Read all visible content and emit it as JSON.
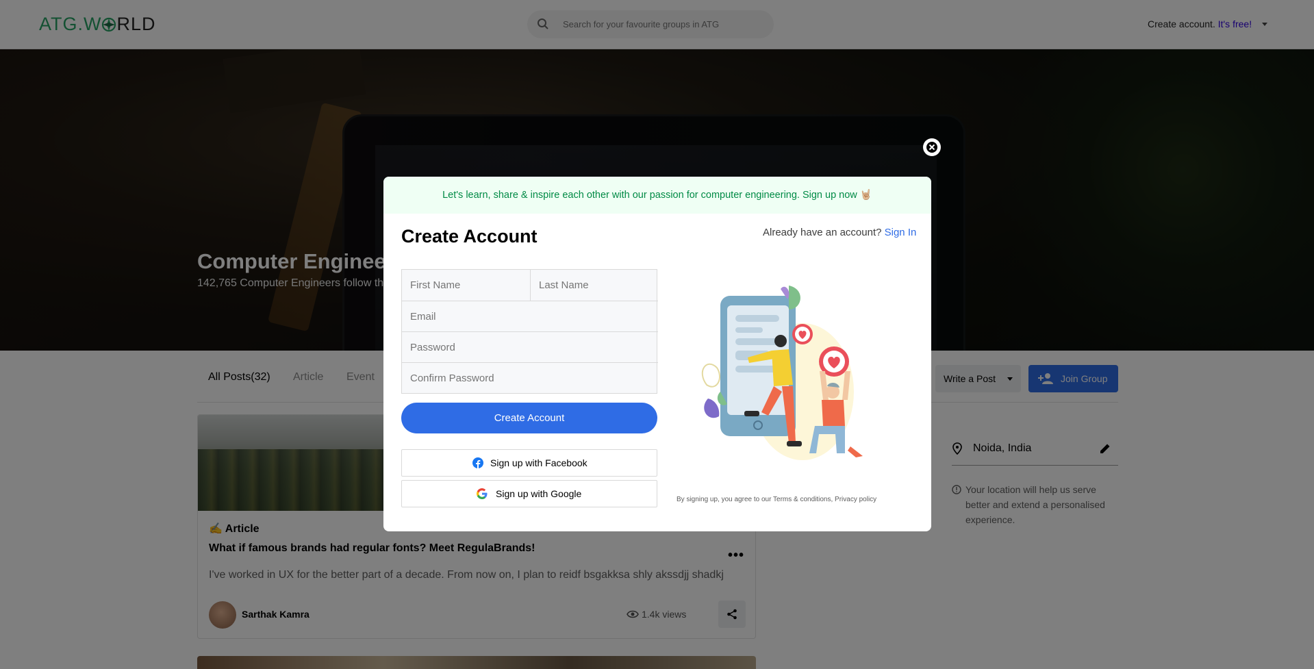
{
  "header": {
    "logo_text_a": "ATG.W",
    "logo_text_b": "RLD",
    "search_placeholder": "Search for your favourite groups in ATG",
    "create_account_label": "Create account.",
    "free_label": "It's free!"
  },
  "banner": {
    "title": "Computer Engineer",
    "subtitle": "142,765 Computer Engineers follow th"
  },
  "tabs": [
    {
      "label": "All Posts(32)"
    },
    {
      "label": "Article"
    },
    {
      "label": "Event"
    }
  ],
  "actions": {
    "write_post": "Write a Post",
    "join_group": "Join Group"
  },
  "post": {
    "type": "✍️ Article",
    "title": "What if famous brands had regular fonts? Meet RegulaBrands!",
    "more": "•••",
    "body": "I've worked in UX for the better part of a decade. From now on, I plan to reidf bsgakksa shly akssdjj shadkj",
    "author": "Sarthak Kamra",
    "views": "1.4k views"
  },
  "sidebar": {
    "location": "Noida, India",
    "location_note": "Your location will help us serve better and extend a personalised experience."
  },
  "modal": {
    "banner_text": "Let's learn, share & inspire each other with our passion for computer engineering. Sign up now 🤘🏼",
    "title": "Create Account",
    "already_text": "Already have an account?",
    "sign_in": "Sign In",
    "fields": {
      "first_name": "First Name",
      "last_name": "Last Name",
      "email": "Email",
      "password": "Password",
      "confirm_password": "Confirm Password"
    },
    "create_button": "Create Account",
    "facebook_button": "Sign up with Facebook",
    "google_button": "Sign up with Google",
    "terms": "By signing up, you agree to our Terms & conditions, Privacy policy"
  },
  "colors": {
    "brand_green": "#27a365",
    "primary_blue": "#2f6ce5",
    "banner_green_text": "#008a45",
    "modal_banner_bg": "#effff4"
  }
}
